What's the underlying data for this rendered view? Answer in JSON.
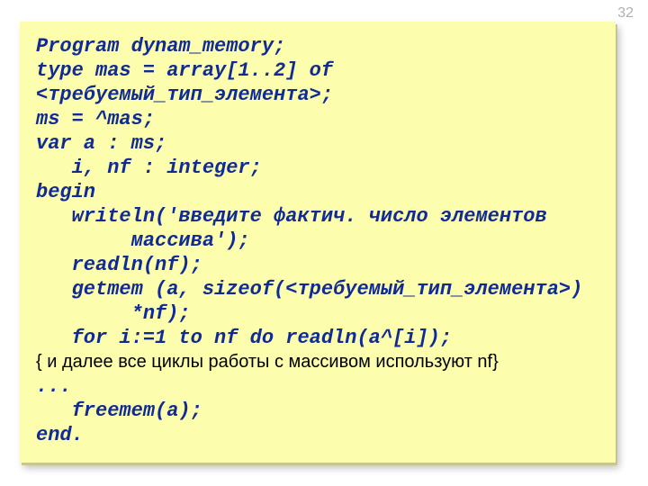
{
  "page_number": "32",
  "code": {
    "l1": "Program dynam_memory;",
    "l2": "type mas = array[1..2] of",
    "l3": "<требуемый_тип_элемента>;",
    "l4": "ms = ^mas;",
    "l5": "var a : ms;",
    "l6": "   i, nf : integer;",
    "l7": "begin",
    "l8": "   writeln('введите фактич. число элементов",
    "l9": "        массива');",
    "l10": "   readln(nf);",
    "l11": "   getmem (a, sizeof(<требуемый_тип_элемента>)",
    "l12": "        *nf);",
    "l13": "   for i:=1 to nf do readln(a^[i]);",
    "l14_comment": "{ и далее все циклы работы с массивом используют nf}",
    "l15": "...",
    "l16": "   freemem(a);",
    "l17": "end."
  }
}
